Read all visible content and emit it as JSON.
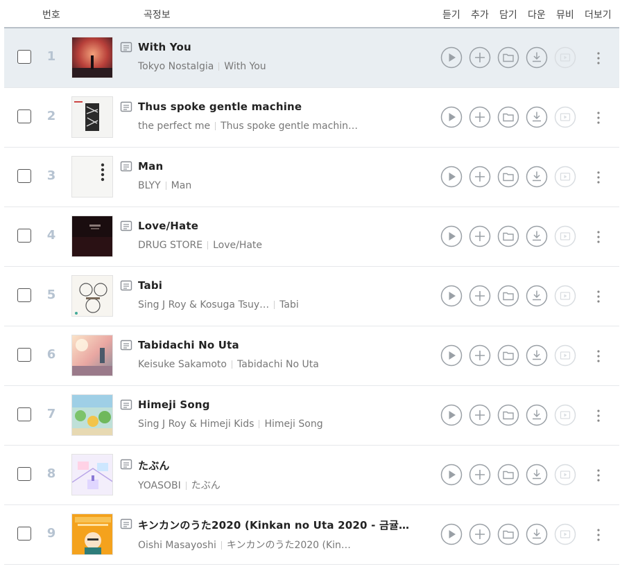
{
  "header": {
    "number": "번호",
    "song_info": "곡정보",
    "listen": "듣기",
    "add": "추가",
    "save": "담기",
    "download": "다운",
    "mv": "뮤비",
    "more": "더보기"
  },
  "colors": {
    "active_row": "#e9eef2",
    "number": "#b6c3d1",
    "icon": "#9aa0a6",
    "icon_disabled": "#d9dde1"
  },
  "icons": [
    "lyrics-icon",
    "play-icon",
    "add-icon",
    "folder-icon",
    "download-icon",
    "mv-icon",
    "more-icon"
  ],
  "songs": [
    {
      "num": "1",
      "title": "With You",
      "artist": "Tokyo Nostalgia",
      "album": "With You",
      "active": true
    },
    {
      "num": "2",
      "title": "Thus spoke gentle machine",
      "artist": "the perfect me",
      "album": "Thus spoke gentle machin…"
    },
    {
      "num": "3",
      "title": "Man",
      "artist": "BLYY",
      "album": "Man"
    },
    {
      "num": "4",
      "title": "Love/Hate",
      "artist": "DRUG STORE",
      "album": "Love/Hate"
    },
    {
      "num": "5",
      "title": "Tabi",
      "artist": "Sing J Roy & Kosuga Tsuy…",
      "album": "Tabi"
    },
    {
      "num": "6",
      "title": "Tabidachi No Uta",
      "artist": "Keisuke Sakamoto",
      "album": "Tabidachi No Uta"
    },
    {
      "num": "7",
      "title": "Himeji Song",
      "artist": "Sing J Roy & Himeji Kids",
      "album": "Himeji Song"
    },
    {
      "num": "8",
      "title": "たぶん",
      "artist": "YOASOBI",
      "album": "たぶん"
    },
    {
      "num": "9",
      "title": "キンカンのうた2020 (Kinkan no Uta 2020 - 금귤…",
      "artist": "Oishi Masayoshi",
      "album": "キンカンのうた2020 (Kin…"
    }
  ]
}
